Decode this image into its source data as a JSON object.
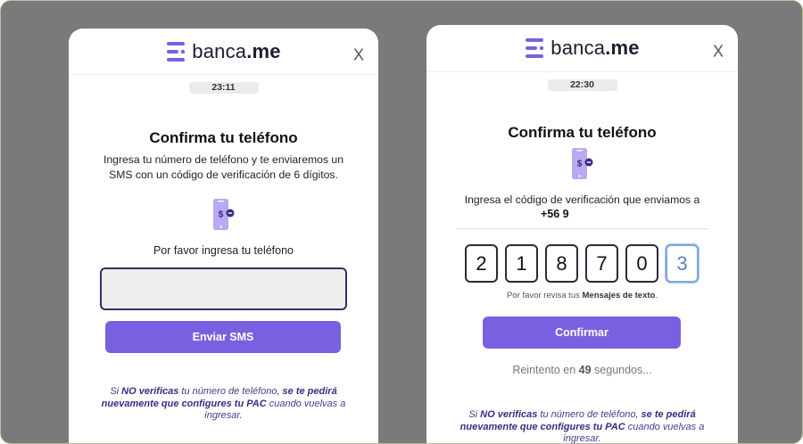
{
  "brand": {
    "name_prefix": "banca",
    "name_suffix": ".me",
    "accent": "#7a60e0",
    "logo_icon": "banca-me-logo-icon"
  },
  "close_label": "X",
  "left_card": {
    "timer": "23:11",
    "title": "Confirma tu teléfono",
    "description": "Ingresa tu número de teléfono y te enviaremos un SMS con un código de verificación de 6 dígitos.",
    "prompt": "Por favor ingresa tu teléfono",
    "phone_input_value": "",
    "button_label": "Enviar SMS",
    "note": {
      "p1": "Si ",
      "b1": "NO verificas",
      "p2": " tu número de teléfono, ",
      "b2": "se te pedirá nuevamente que configures tu PAC",
      "p3": " cuando vuelvas a ingresar."
    }
  },
  "right_card": {
    "timer": "22:30",
    "title": "Confirma tu teléfono",
    "code_intro": "Ingresa el código de verificación que enviamos a",
    "phone_number": "+56 9",
    "code_digits": [
      "2",
      "1",
      "8",
      "7",
      "0",
      "3"
    ],
    "hint_prefix": "Por favor revisa tus ",
    "hint_bold": "Mensajes de texto",
    "hint_suffix": ".",
    "button_label": "Confirmar",
    "retry_prefix": "Reintento en ",
    "retry_seconds": "49",
    "retry_suffix": " segundos...",
    "note": {
      "p1": "Si ",
      "b1": "NO verificas",
      "p2": " tu número de teléfono, ",
      "b2": "se te pedirá nuevamente que configures tu PAC",
      "p3": " cuando vuelvas a ingresar."
    }
  }
}
